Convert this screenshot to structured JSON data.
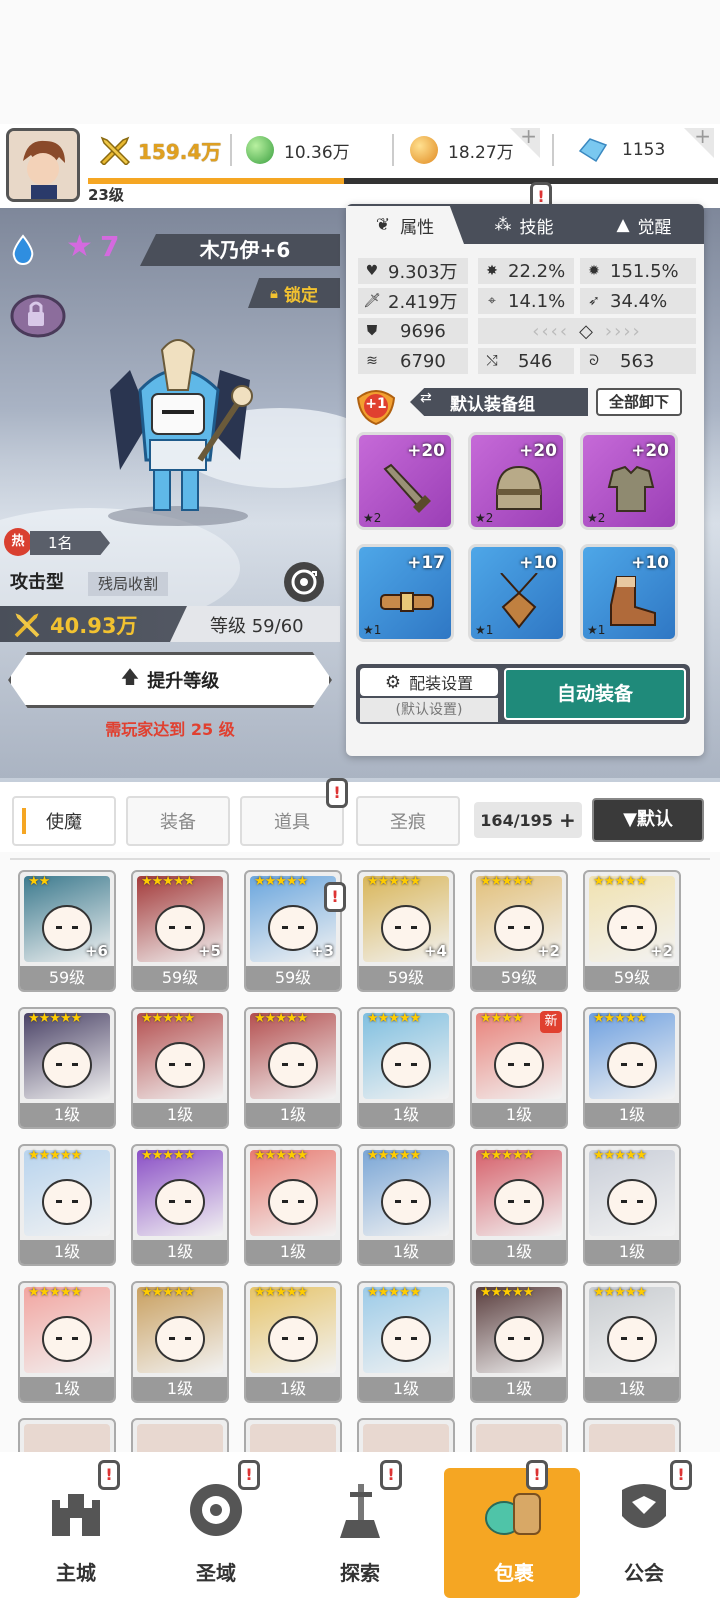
{
  "player": {
    "level": "23级"
  },
  "resources": {
    "power": "159.4万",
    "green": "10.36万",
    "gold": "18.27万",
    "gem": "1153"
  },
  "hero": {
    "stars": "7",
    "name": "木乃伊+6",
    "lock": "锁定",
    "hot_rank_icon": "热",
    "hot_rank": "1名",
    "type": "攻击型",
    "tag": "残局收割",
    "power": "40.93万",
    "level_label": "等级 59/60",
    "upgrade_button": "提升等级",
    "requirement": "需玩家达到 25 级"
  },
  "panel": {
    "tabs": [
      {
        "label": "属性"
      },
      {
        "label": "技能"
      },
      {
        "label": "觉醒"
      }
    ],
    "stats": {
      "hp": "9.303万",
      "crit": "22.2%",
      "crit_dmg": "151.5%",
      "atk": "2.419万",
      "hit": "14.1%",
      "dodge": "34.4%",
      "def": "9696",
      "speed": "6790",
      "pierce": "546",
      "resist": "563"
    },
    "equip_badge": "+1",
    "equip_group": "默认装备组",
    "unequip_all": "全部卸下",
    "equips": [
      {
        "level": "+20",
        "stars": "★2",
        "icon": "sword-icon",
        "rarity": "purple"
      },
      {
        "level": "+20",
        "stars": "★2",
        "icon": "helmet-icon",
        "rarity": "purple"
      },
      {
        "level": "+20",
        "stars": "★2",
        "icon": "armor-icon",
        "rarity": "purple"
      },
      {
        "level": "+17",
        "stars": "★1",
        "icon": "belt-icon",
        "rarity": "blue"
      },
      {
        "level": "+10",
        "stars": "★1",
        "icon": "amulet-icon",
        "rarity": "blue"
      },
      {
        "level": "+10",
        "stars": "★1",
        "icon": "boots-icon",
        "rarity": "blue"
      }
    ],
    "config_button": "配装设置",
    "config_sub": "(默认设置)",
    "auto_equip": "自动装备"
  },
  "filter": {
    "tabs": [
      {
        "label": "使魔"
      },
      {
        "label": "装备"
      },
      {
        "label": "道具"
      },
      {
        "label": "圣痕"
      }
    ],
    "capacity": "164/195",
    "sort": "▼默认"
  },
  "grid": [
    {
      "level": "59级",
      "stars": "★★",
      "plus": "+6",
      "color": "#3c7a8e"
    },
    {
      "level": "59级",
      "stars": "★★★★★",
      "plus": "+5",
      "color": "#a33a3a"
    },
    {
      "level": "59级",
      "stars": "★★★★★",
      "plus": "+3",
      "color": "#6aa6de"
    },
    {
      "level": "59级",
      "stars": "★★★★★",
      "plus": "+4",
      "color": "#d9b65a"
    },
    {
      "level": "59级",
      "stars": "★★★★★",
      "plus": "+2",
      "color": "#e2c07a"
    },
    {
      "level": "59级",
      "stars": "★★★★★",
      "plus": "+2",
      "color": "#f1e2b0"
    },
    {
      "level": "1级",
      "stars": "★★★★★",
      "plus": "",
      "color": "#4a4266"
    },
    {
      "level": "1级",
      "stars": "★★★★★",
      "plus": "",
      "color": "#b44f4f"
    },
    {
      "level": "1级",
      "stars": "★★★★★",
      "plus": "",
      "color": "#b44f4f"
    },
    {
      "level": "1级",
      "stars": "★★★★★",
      "plus": "",
      "color": "#7fbfe0"
    },
    {
      "level": "1级",
      "stars": "★★★★",
      "plus": "",
      "color": "#e8827a",
      "new": "新"
    },
    {
      "level": "1级",
      "stars": "★★★★★",
      "plus": "",
      "color": "#6ea0e0"
    },
    {
      "level": "1级",
      "stars": "★★★★★",
      "plus": "",
      "color": "#b8d4ee"
    },
    {
      "level": "1级",
      "stars": "★★★★★",
      "plus": "",
      "color": "#8a4fc6"
    },
    {
      "level": "1级",
      "stars": "★★★★★",
      "plus": "",
      "color": "#e87a70"
    },
    {
      "level": "1级",
      "stars": "★★★★★",
      "plus": "",
      "color": "#7aa6d6"
    },
    {
      "level": "1级",
      "stars": "★★★★★",
      "plus": "",
      "color": "#d6606a"
    },
    {
      "level": "1级",
      "stars": "★★★★★",
      "plus": "",
      "color": "#c9ced8"
    },
    {
      "level": "1级",
      "stars": "★★★★★",
      "plus": "",
      "color": "#f2a5a0"
    },
    {
      "level": "1级",
      "stars": "★★★★★",
      "plus": "",
      "color": "#c9a060"
    },
    {
      "level": "1级",
      "stars": "★★★★★",
      "plus": "",
      "color": "#e6c46a"
    },
    {
      "level": "1级",
      "stars": "★★★★★",
      "plus": "",
      "color": "#9ccbe8"
    },
    {
      "level": "1级",
      "stars": "★★★★★",
      "plus": "",
      "color": "#5a3e3e"
    },
    {
      "level": "1级",
      "stars": "★★★★★",
      "plus": "",
      "color": "#c8ccd0"
    }
  ],
  "nav": [
    {
      "label": "主城",
      "icon": "castle-icon"
    },
    {
      "label": "圣域",
      "icon": "portal-icon"
    },
    {
      "label": "探索",
      "icon": "sword-stone-icon"
    },
    {
      "label": "包裹",
      "icon": "bag-icon",
      "active": true
    },
    {
      "label": "公会",
      "icon": "guild-icon"
    }
  ]
}
